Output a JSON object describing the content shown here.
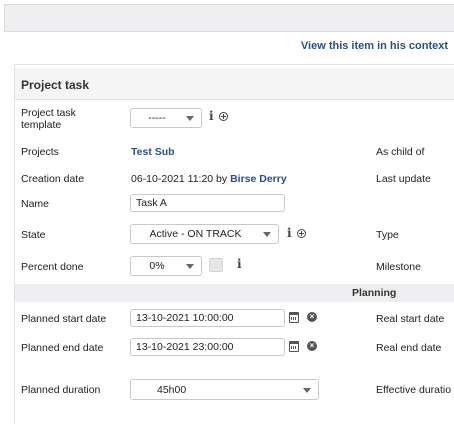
{
  "header": {
    "context_link": "View this item in his context",
    "section_title": "Project task"
  },
  "fields": {
    "template": {
      "label": "Project task template",
      "value": "-----"
    },
    "projects": {
      "label": "Projects",
      "value": "Test Sub"
    },
    "creation": {
      "label": "Creation date",
      "value_prefix": "06-10-2021 11:20 by",
      "user": "Birse Derry"
    },
    "name": {
      "label": "Name",
      "value": "Task A"
    },
    "state": {
      "label": "State",
      "value": "Active - ON TRACK"
    },
    "percent": {
      "label": "Percent done",
      "value": "0%"
    }
  },
  "right_labels": {
    "as_child_of": "As child of",
    "last_update": "Last update",
    "type": "Type",
    "milestone": "Milestone",
    "real_start": "Real start date",
    "real_end": "Real end date",
    "effective_duration": "Effective duratio"
  },
  "planning": {
    "title": "Planning",
    "start": {
      "label": "Planned start date",
      "value": "13-10-2021 10:00:00"
    },
    "end": {
      "label": "Planned end date",
      "value": "13-10-2021 23:00:00"
    },
    "duration": {
      "label": "Planned duration",
      "value": "45h00"
    }
  },
  "icons": {
    "info": "i",
    "calendar": "calendar-icon",
    "clear": "×"
  }
}
